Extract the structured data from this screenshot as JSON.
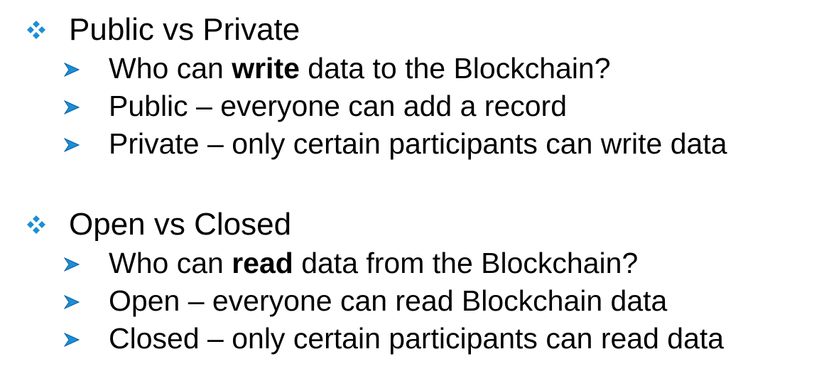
{
  "sections": [
    {
      "heading": "Public vs Private",
      "bullets": [
        {
          "pre": "Who can ",
          "bold": "write",
          "post": " data to the Blockchain?"
        },
        {
          "pre": "Public – everyone can add a record",
          "bold": "",
          "post": ""
        },
        {
          "pre": "Private – only certain participants can write data",
          "bold": "",
          "post": ""
        }
      ]
    },
    {
      "heading": "Open vs Closed",
      "bullets": [
        {
          "pre": "Who can ",
          "bold": "read",
          "post": " data from the Blockchain?"
        },
        {
          "pre": "Open – everyone can read Blockchain data",
          "bold": "",
          "post": ""
        },
        {
          "pre": "Closed – only certain participants can read data",
          "bold": "",
          "post": ""
        }
      ]
    }
  ],
  "icons": {
    "section_bullet": "four-diamond-icon",
    "item_bullet": "arrowhead-icon"
  },
  "colors": {
    "bullet": "#1a8fd6",
    "bullet_dark": "#0b5f9e",
    "text": "#000000"
  }
}
